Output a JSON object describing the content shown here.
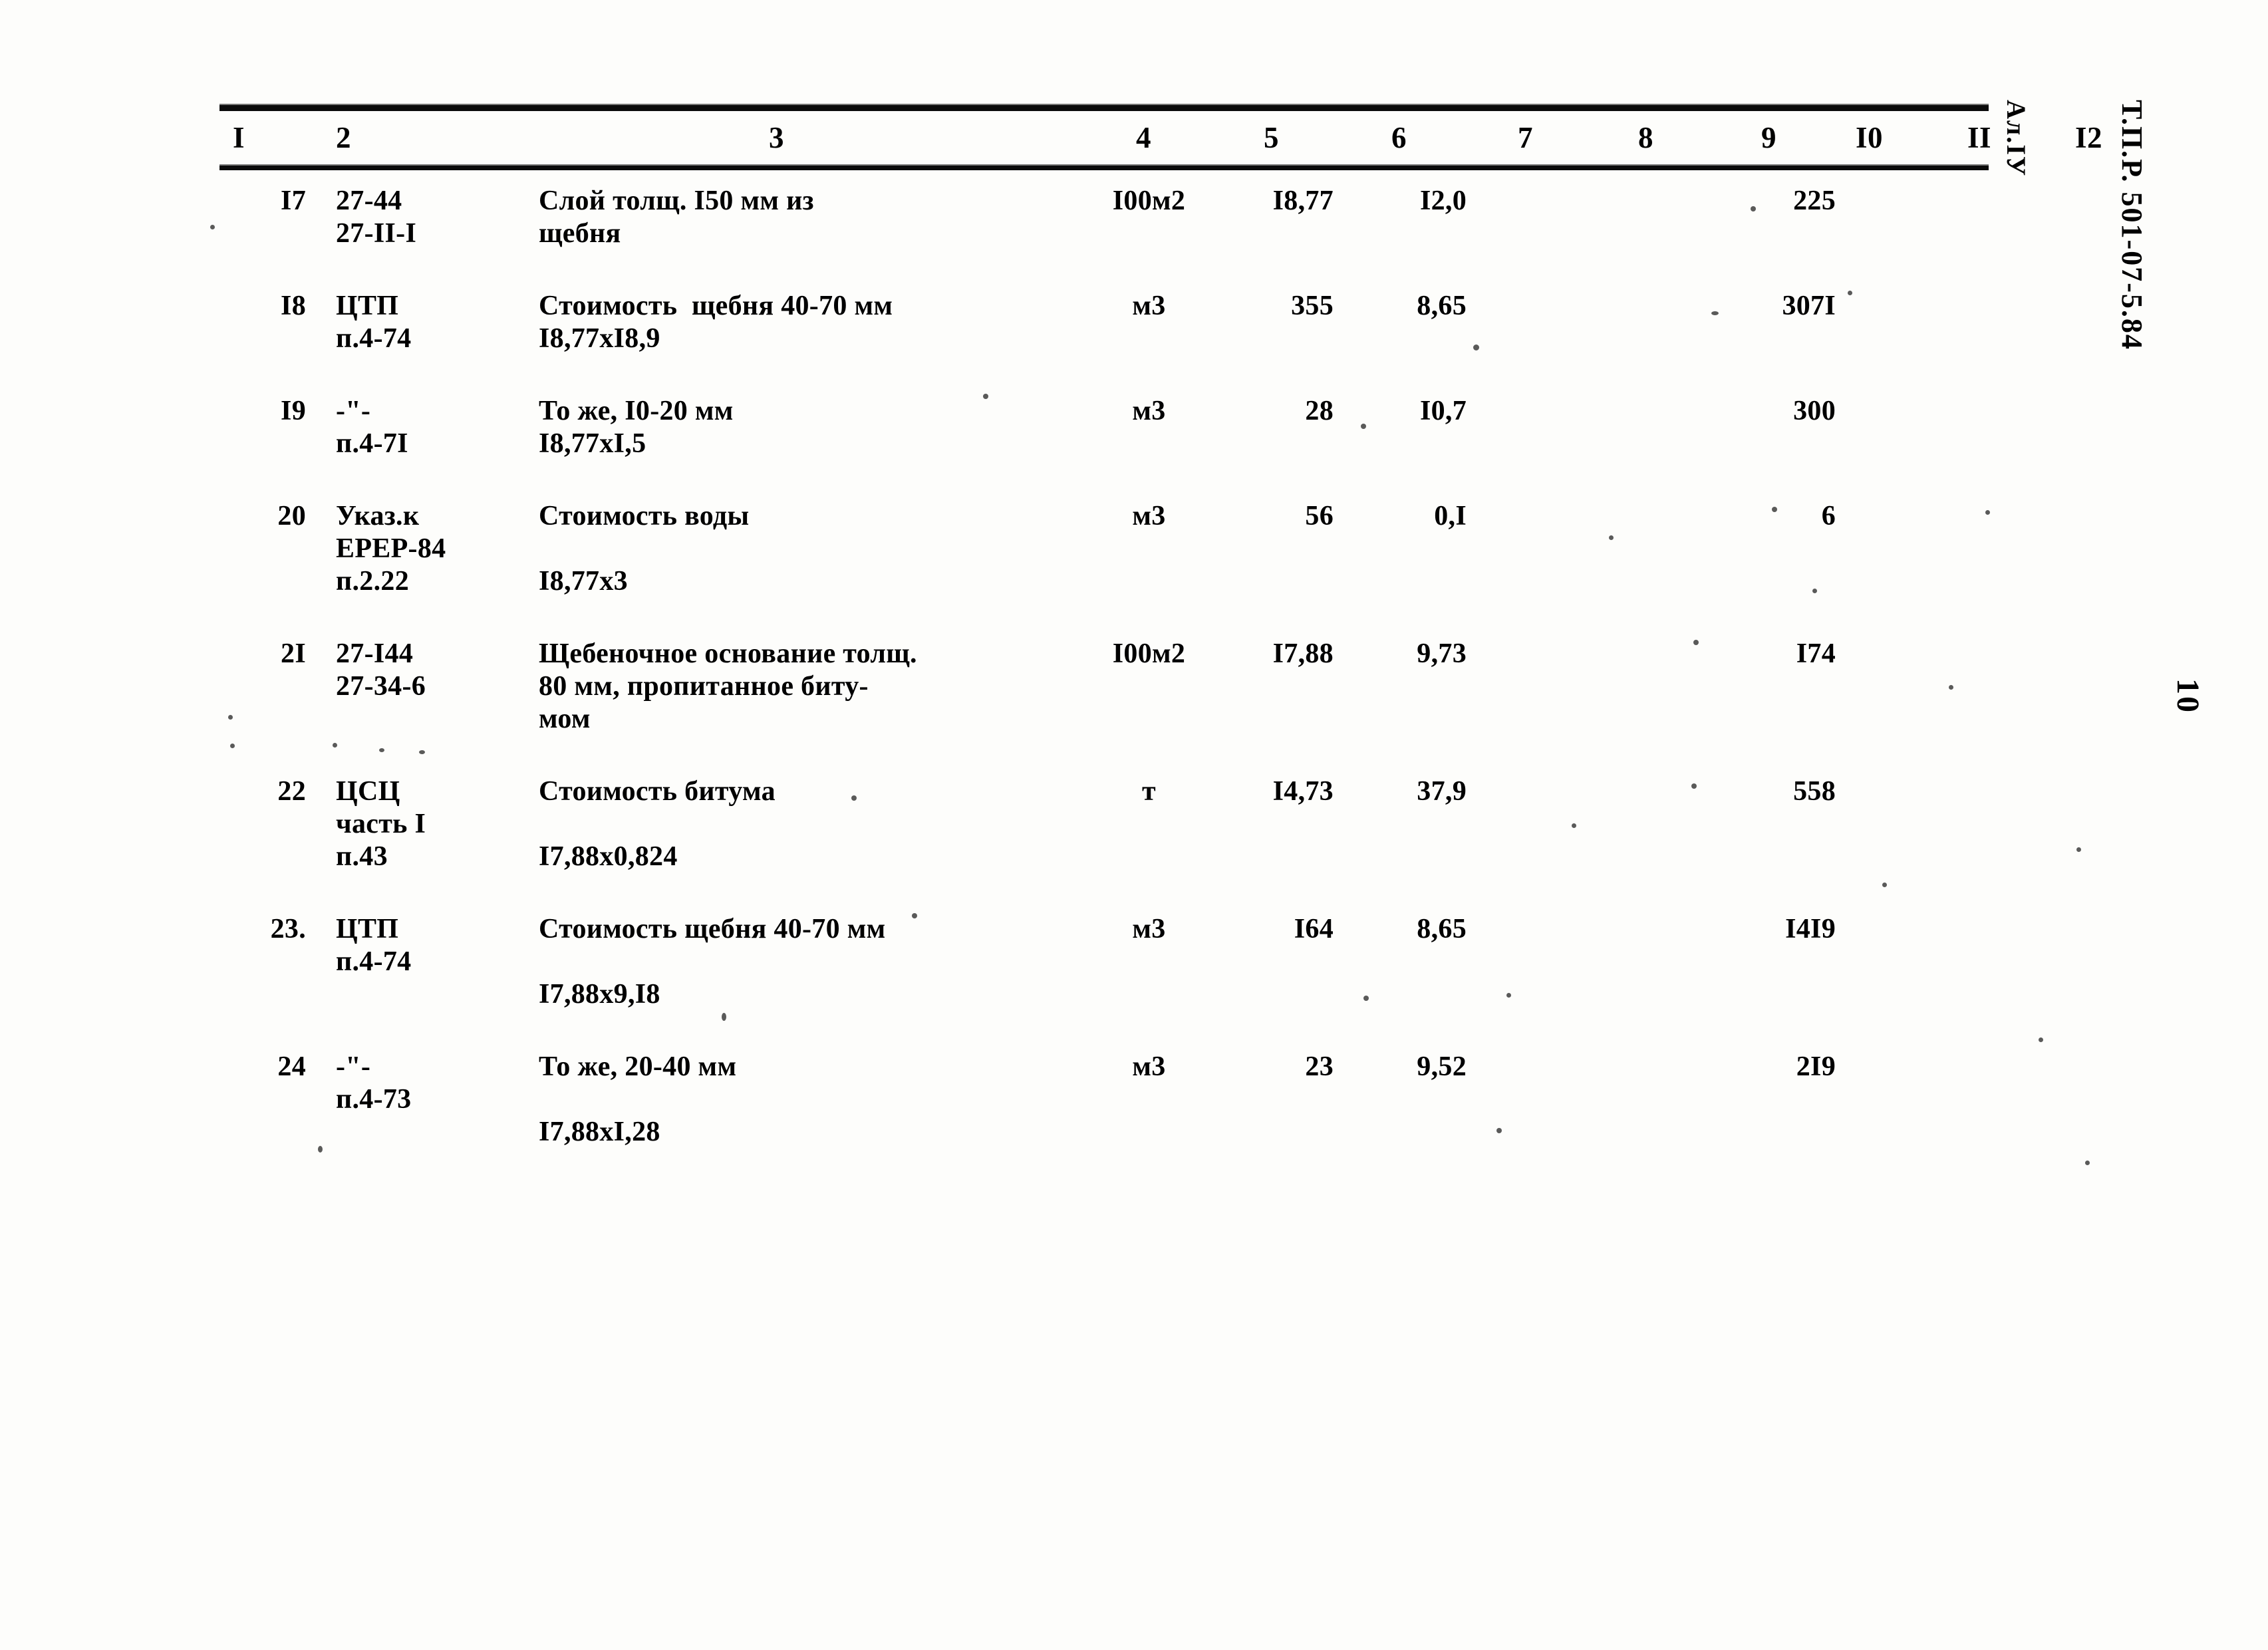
{
  "document": {
    "imprint_line1": "Т.П.Р. 501-07-5.84",
    "imprint_line2": "Ал.IУ",
    "page_number": "10"
  },
  "table": {
    "column_headers": [
      "I",
      "2",
      "3",
      "4",
      "5",
      "6",
      "7",
      "8",
      "9",
      "I0",
      "II",
      "I2"
    ],
    "rows": [
      {
        "num": "I7",
        "code": "27-44\n27-II-I",
        "desc": "Слой толщ. I50 мм из\nщебня",
        "unit": "I00м2",
        "qty": "I8,77",
        "price": "I2,0",
        "c7": "",
        "c8": "",
        "total": "225",
        "c10": "",
        "c11": "",
        "c12": ""
      },
      {
        "num": "I8",
        "code": "ЦТП\nп.4-74",
        "desc": "Стоимость  щебня 40-70 мм\nI8,77xI8,9",
        "unit": "м3",
        "qty": "355",
        "price": "8,65",
        "c7": "",
        "c8": "",
        "total": "307I",
        "c10": "",
        "c11": "",
        "c12": ""
      },
      {
        "num": "I9",
        "code": "-\"-\nп.4-7I",
        "desc": "То же, I0-20 мм\nI8,77xI,5",
        "unit": "м3",
        "qty": "28",
        "price": "I0,7",
        "c7": "",
        "c8": "",
        "total": "300",
        "c10": "",
        "c11": "",
        "c12": ""
      },
      {
        "num": "20",
        "code": "Указ.к\nЕРЕР-84\nп.2.22",
        "desc": "Стоимость воды\n\nI8,77x3",
        "unit": "м3",
        "qty": "56",
        "price": "0,I",
        "c7": "",
        "c8": "",
        "total": "6",
        "c10": "",
        "c11": "",
        "c12": ""
      },
      {
        "num": "2I",
        "code": "27-I44\n27-34-6",
        "desc": "Щебеночное основание толщ.\n80 мм, пропитанное биту-\nмом",
        "unit": "I00м2",
        "qty": "I7,88",
        "price": "9,73",
        "c7": "",
        "c8": "",
        "total": "I74",
        "c10": "",
        "c11": "",
        "c12": ""
      },
      {
        "num": "22",
        "code": "ЦСЦ\nчасть I\nп.43",
        "desc": "Стоимость битума\n\nI7,88x0,824",
        "unit": "т",
        "qty": "I4,73",
        "price": "37,9",
        "c7": "",
        "c8": "",
        "total": "558",
        "c10": "",
        "c11": "",
        "c12": ""
      },
      {
        "num": "23.",
        "code": "ЦТП\nп.4-74",
        "desc": "Стоимость щебня 40-70 мм\n\nI7,88x9,I8",
        "unit": "м3",
        "qty": "I64",
        "price": "8,65",
        "c7": "",
        "c8": "",
        "total": "I4I9",
        "c10": "",
        "c11": "",
        "c12": ""
      },
      {
        "num": "24",
        "code": "-\"-\nп.4-73",
        "desc": "То же, 20-40 мм\n\nI7,88xI,28",
        "unit": "м3",
        "qty": "23",
        "price": "9,52",
        "c7": "",
        "c8": "",
        "total": "2I9",
        "c10": "",
        "c11": "",
        "c12": ""
      }
    ]
  }
}
